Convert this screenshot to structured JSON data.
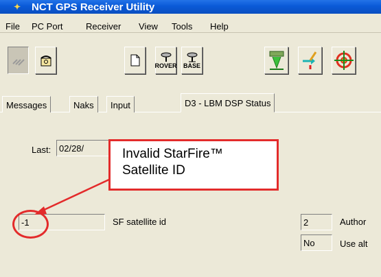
{
  "window": {
    "title": "NCT GPS Receiver Utility"
  },
  "menu": [
    "File",
    "PC Port",
    "Receiver",
    "View",
    "Tools",
    "Help"
  ],
  "toolbar": {
    "rover_label": "ROVER",
    "base_label": "BASE"
  },
  "tabs": [
    "Messages",
    "Naks",
    "Input",
    "D3 - LBM DSP Status"
  ],
  "status": {
    "last_label": "Last:",
    "last_value": "02/28/"
  },
  "fields": {
    "sf_satellite_id": {
      "value": "-1",
      "label": "SF satellite id"
    },
    "author": {
      "value": "2",
      "label": "Author"
    },
    "use_alt": {
      "value": "No",
      "label": "Use alt"
    }
  },
  "annotation": {
    "line1": "Invalid StarFire™",
    "line2": "Satellite ID",
    "color": "#e32b2b"
  }
}
